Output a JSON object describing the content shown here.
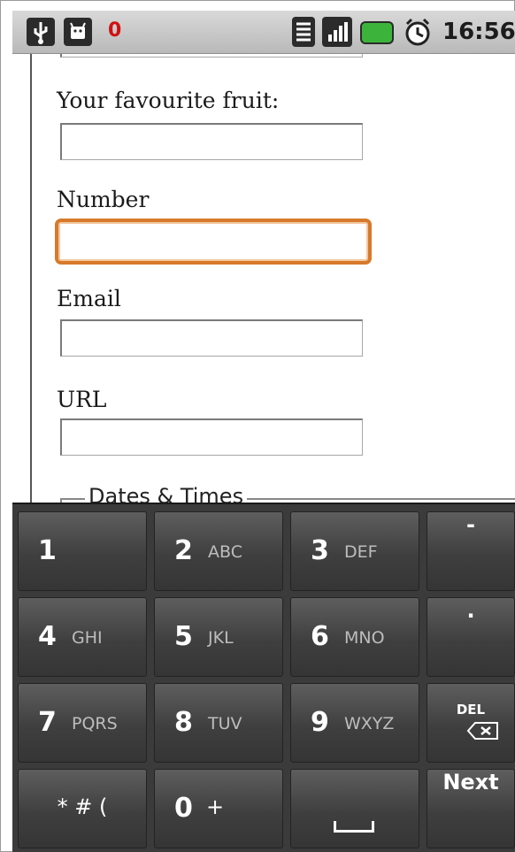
{
  "status_bar": {
    "notification_count": "0",
    "time": "16:56",
    "icons": [
      "usb-icon",
      "android-icon",
      "wifi-icon",
      "signal-icon",
      "battery-icon",
      "alarm-icon"
    ]
  },
  "form": {
    "fruit_label": "Your favourite fruit:",
    "fruit_value": "",
    "number_label": "Number",
    "number_value": "",
    "email_label": "Email",
    "email_value": "",
    "url_label": "URL",
    "url_value": "",
    "legend": "Dates & Times"
  },
  "keyboard": {
    "rows": [
      [
        {
          "main": "1",
          "sub": ""
        },
        {
          "main": "2",
          "sub": "ABC"
        },
        {
          "main": "3",
          "sub": "DEF"
        },
        {
          "main": "-",
          "sub": ""
        }
      ],
      [
        {
          "main": "4",
          "sub": "GHI"
        },
        {
          "main": "5",
          "sub": "JKL"
        },
        {
          "main": "6",
          "sub": "MNO"
        },
        {
          "main": ".",
          "sub": ""
        }
      ],
      [
        {
          "main": "7",
          "sub": "PQRS"
        },
        {
          "main": "8",
          "sub": "TUV"
        },
        {
          "main": "9",
          "sub": "WXYZ"
        },
        {
          "main": "DEL",
          "sub": ""
        }
      ],
      [
        {
          "main": "* # (",
          "sub": ""
        },
        {
          "main": "0",
          "sub": "+"
        },
        {
          "main": "",
          "sub": ""
        },
        {
          "main": "Next",
          "sub": ""
        }
      ]
    ]
  },
  "colors": {
    "focus_border": "#d77a2b",
    "keyboard_bg": "#3b3b3b",
    "battery": "#3cb43c",
    "notification": "#d01010"
  }
}
